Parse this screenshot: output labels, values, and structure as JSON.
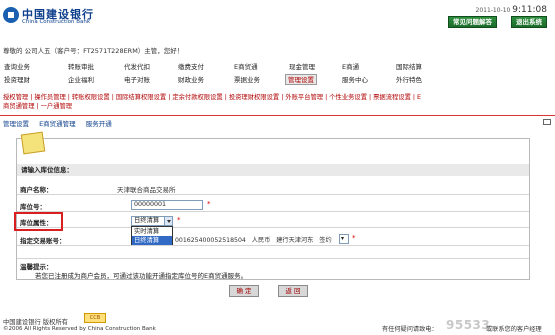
{
  "brand": {
    "name_cn": "中国建设银行",
    "name_en": "China Construction Bank"
  },
  "header": {
    "date": "2011-10-10",
    "time": "9:11:08",
    "help_button": "常见问题解答",
    "exit_button": "退出系统"
  },
  "user_line": "尊敬的 公司人五（客户号：FT2571T228ERM）主管，您好！",
  "nav_row1": [
    "查询业务",
    "转账审批",
    "代发代扣",
    "缴费支付",
    "E商贸通",
    "现金管理",
    "E商通",
    "国际结算"
  ],
  "nav_row2": [
    "投资理财",
    "企业福利",
    "电子对账",
    "财政业务",
    "票据业务",
    "管理设置",
    "服务中心",
    "外行特色"
  ],
  "subnav": {
    "line1": "授权管理 | 操作员管理 | 转账权限设置 | 国际结算权限设置 | 定余付款权限设置 | 投资理财权限设置 | 外账平台管理 | 个性业务设置 | 票据流程设置 | E",
    "line2": "商贸通管理 | 一户通管理"
  },
  "tabs": [
    "管理设置",
    "E商贸通管理",
    "服务开通"
  ],
  "form": {
    "section_title": "请输入库位信息：",
    "member_label": "商户名称：",
    "member_value": "天津联合商品交易所",
    "slot_label": "库位号：",
    "slot_value": "00000001",
    "attr_label": "库位属性：",
    "attr_selected": "日终清算",
    "attr_options": [
      "实时清算",
      "日终清算"
    ],
    "account_label": "指定交易账号：",
    "account_number": "001625400052518504",
    "account_currency": "人民币",
    "account_branch": "建行天津河东",
    "account_type": "签约",
    "tips_title": "温馨提示：",
    "tips_text": "若您已注册成为商户会员，可通过该功能开通指定库位号的E商贸通服务。"
  },
  "buttons": {
    "confirm": "确 定",
    "back": "返 回"
  },
  "footer": {
    "logo_text": "中国建设银行 版权所有",
    "stamp": "CCB",
    "copyright": "©2006 All Rights Reserved by China Construction Bank",
    "hotline_label": "有任何疑问请致电：",
    "hotline": "95533",
    "hotline_tail": "或联系您的客户经理"
  },
  "colors": {
    "brand_blue": "#0e3f8c",
    "accent_red": "#b00000",
    "help_green": "#1b6a2a",
    "highlight": "#d81e1e"
  }
}
